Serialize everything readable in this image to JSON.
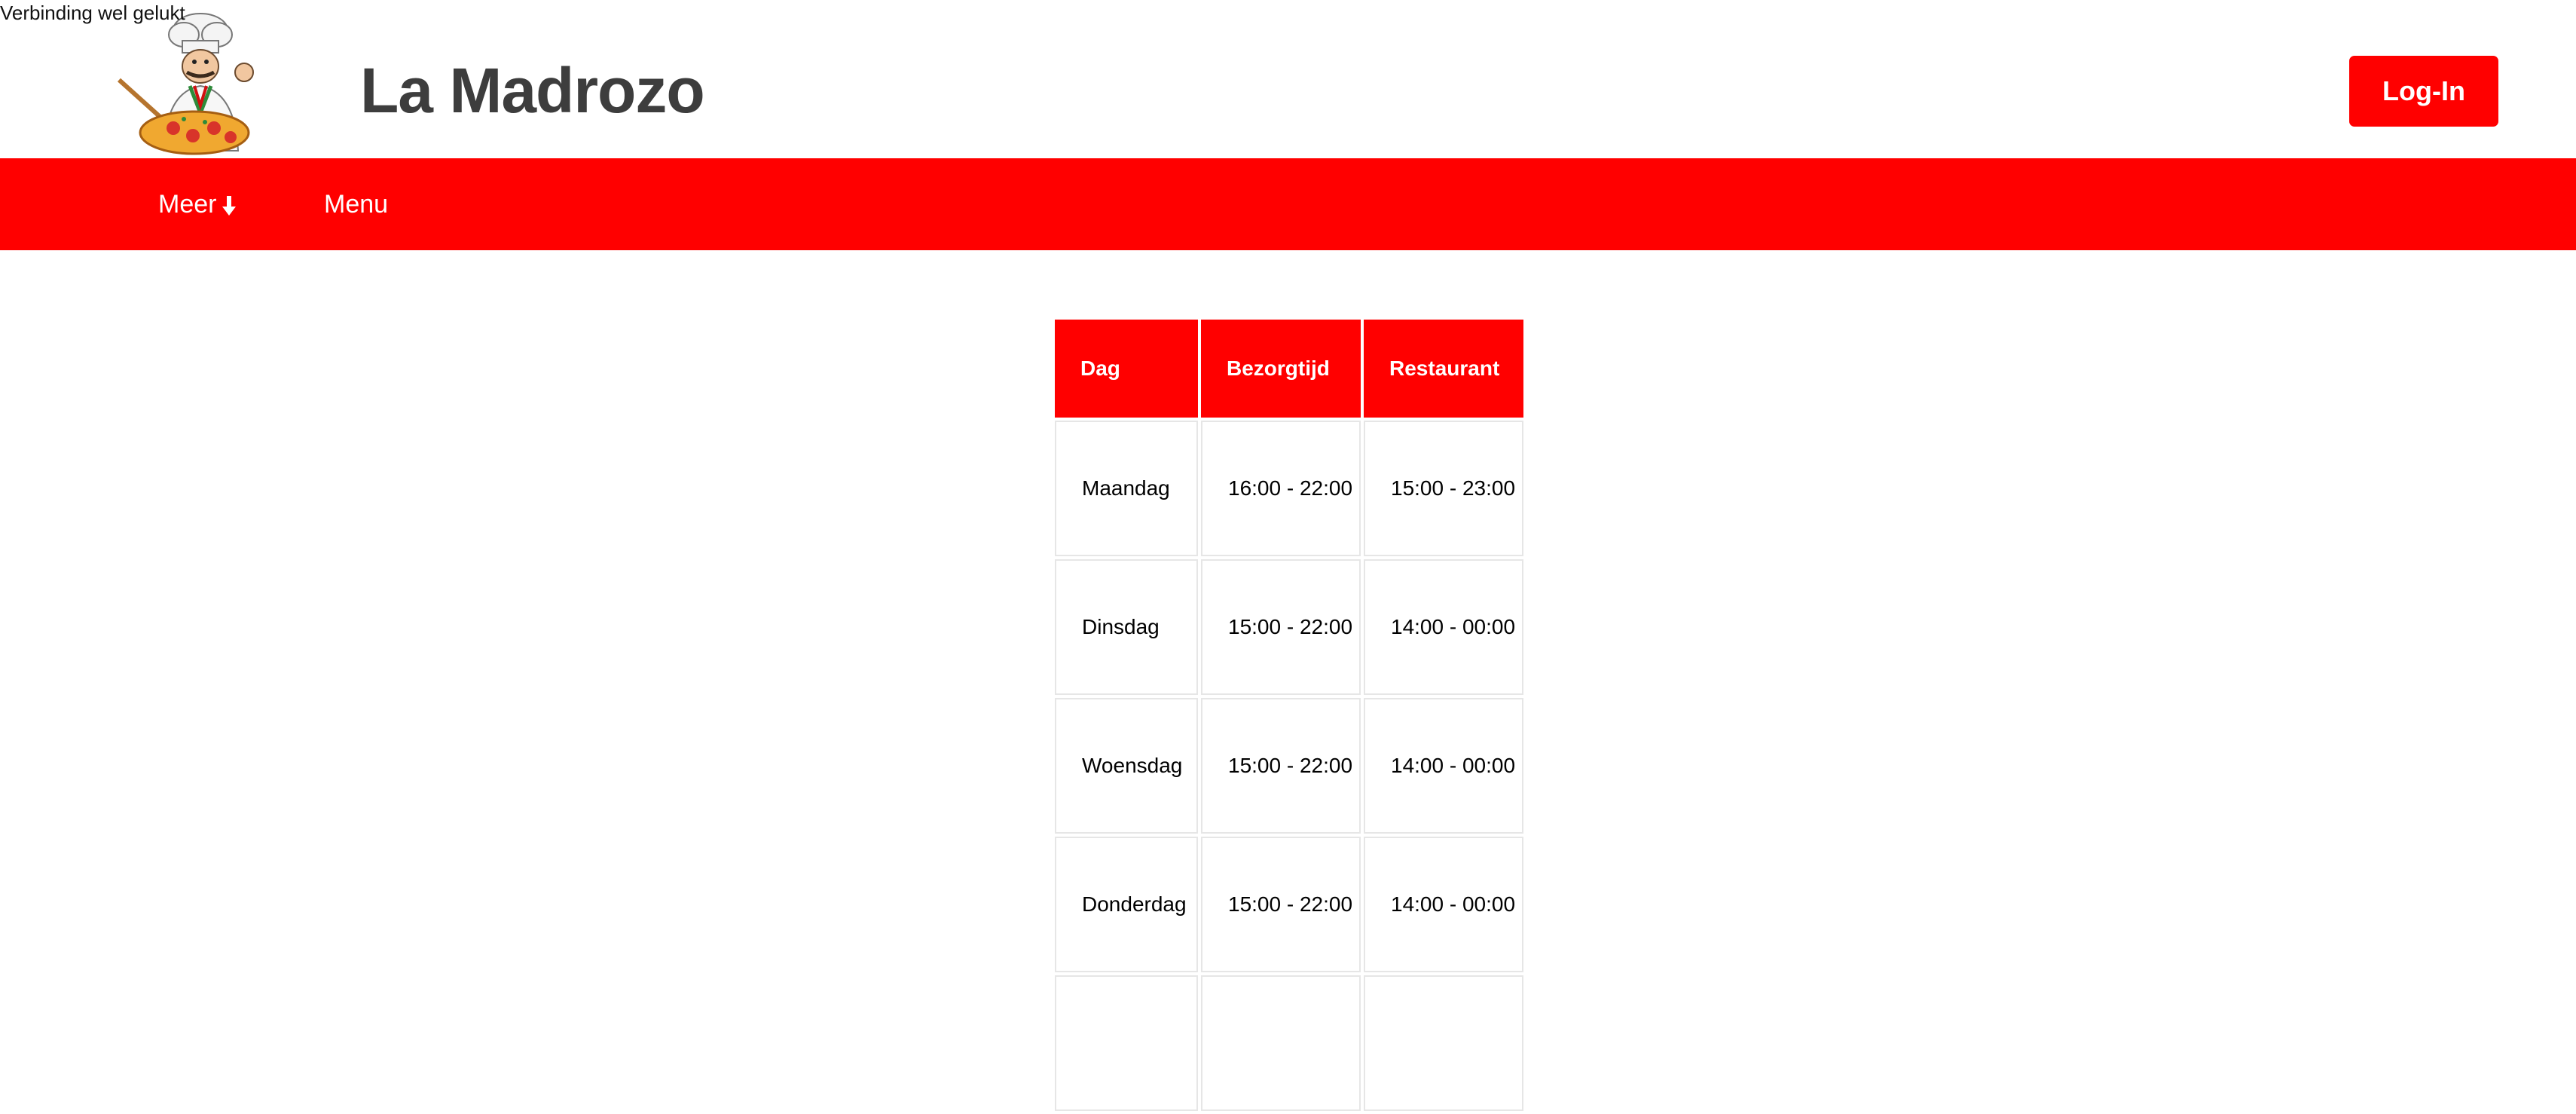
{
  "status": "Verbinding wel gelukt",
  "site": {
    "title": "La Madrozo",
    "login_label": "Log-In"
  },
  "nav": {
    "meer_label": "Meer",
    "menu_label": "Menu"
  },
  "table": {
    "headers": [
      "Dag",
      "Bezorgtijd",
      "Restaurant"
    ],
    "rows": [
      [
        "Maandag",
        "16:00 - 22:00",
        "15:00 - 23:00"
      ],
      [
        "Dinsdag",
        "15:00 - 22:00",
        "14:00 - 00:00"
      ],
      [
        "Woensdag",
        "15:00 - 22:00",
        "14:00 - 00:00"
      ],
      [
        "Donderdag",
        "15:00 - 22:00",
        "14:00 - 00:00"
      ],
      [
        "",
        "",
        ""
      ]
    ]
  },
  "colors": {
    "accent": "#ff0000",
    "title": "#3d3d3d"
  },
  "icons": {
    "logo": "chef-with-pizza-logo",
    "meer_arrow": "arrow-down-icon"
  }
}
